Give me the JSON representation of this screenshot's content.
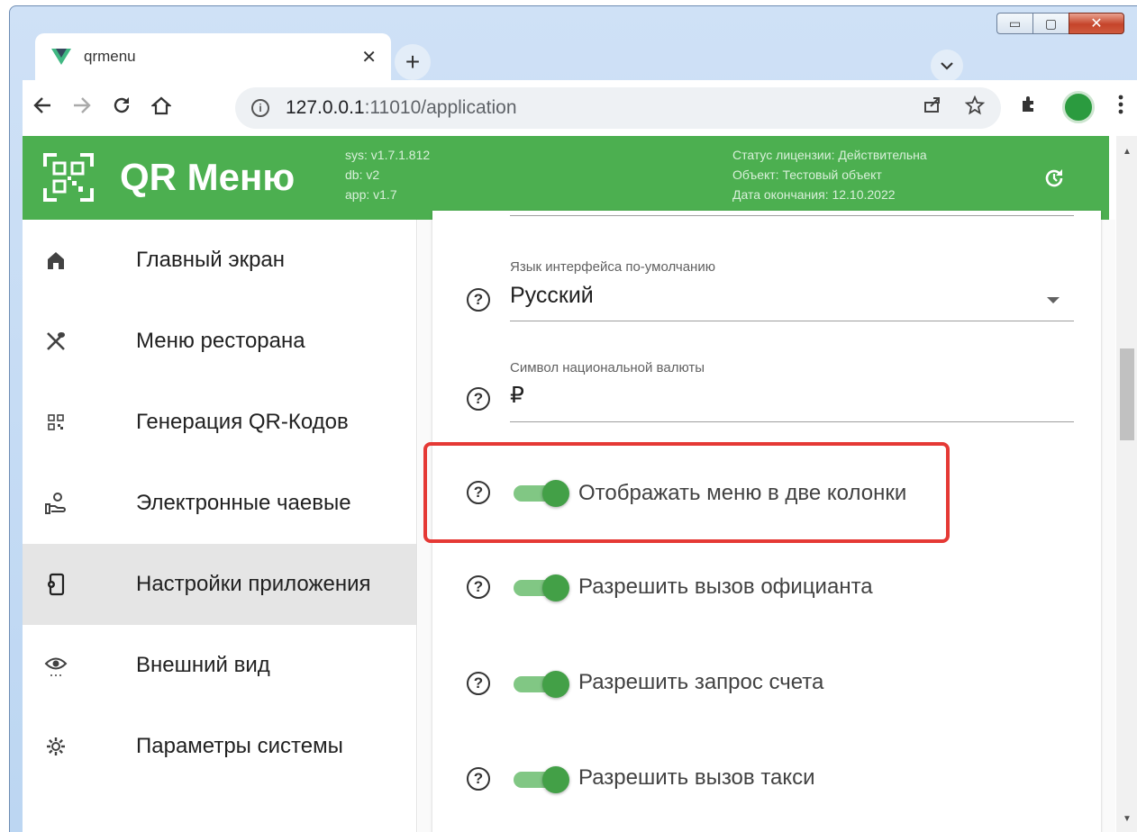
{
  "browser": {
    "tab_title": "qrmenu",
    "tab_close": "✕",
    "new_tab": "+",
    "url_host": "127.0.0.1",
    "url_rest": ":11010/application",
    "window_controls": {
      "minimize": "▭",
      "maximize": "▢",
      "close": "✕"
    }
  },
  "app": {
    "title": "QR Меню",
    "versions": [
      "sys: v1.7.1.812",
      "db: v2",
      "app: v1.7"
    ],
    "license": [
      "Статус лицензии: Действительна",
      "Объект: Тестовый объект",
      "Дата окончания: 12.10.2022"
    ],
    "accent_color": "#4caf50"
  },
  "sidebar": {
    "items": [
      {
        "label": "Главный экран",
        "icon": "home-icon"
      },
      {
        "label": "Меню ресторана",
        "icon": "utensils-icon"
      },
      {
        "label": "Генерация QR-Кодов",
        "icon": "qr-code-icon"
      },
      {
        "label": "Электронные чаевые",
        "icon": "tips-hand-icon"
      },
      {
        "label": "Настройки приложения",
        "icon": "phone-settings-icon",
        "active": true
      },
      {
        "label": "Внешний вид",
        "icon": "eye-icon"
      },
      {
        "label": "Параметры системы",
        "icon": "gear-icon"
      }
    ]
  },
  "settings": {
    "language": {
      "label": "Язык интерфейса по-умолчанию",
      "value": "Русский"
    },
    "currency": {
      "label": "Символ национальной валюты",
      "value": "₽"
    },
    "help_glyph": "?",
    "toggles": [
      {
        "label": "Отображать меню в две колонки",
        "on": true,
        "highlighted": true
      },
      {
        "label": "Разрешить вызов официанта",
        "on": true
      },
      {
        "label": "Разрешить запрос счета",
        "on": true
      },
      {
        "label": "Разрешить вызов такси",
        "on": true
      }
    ]
  }
}
